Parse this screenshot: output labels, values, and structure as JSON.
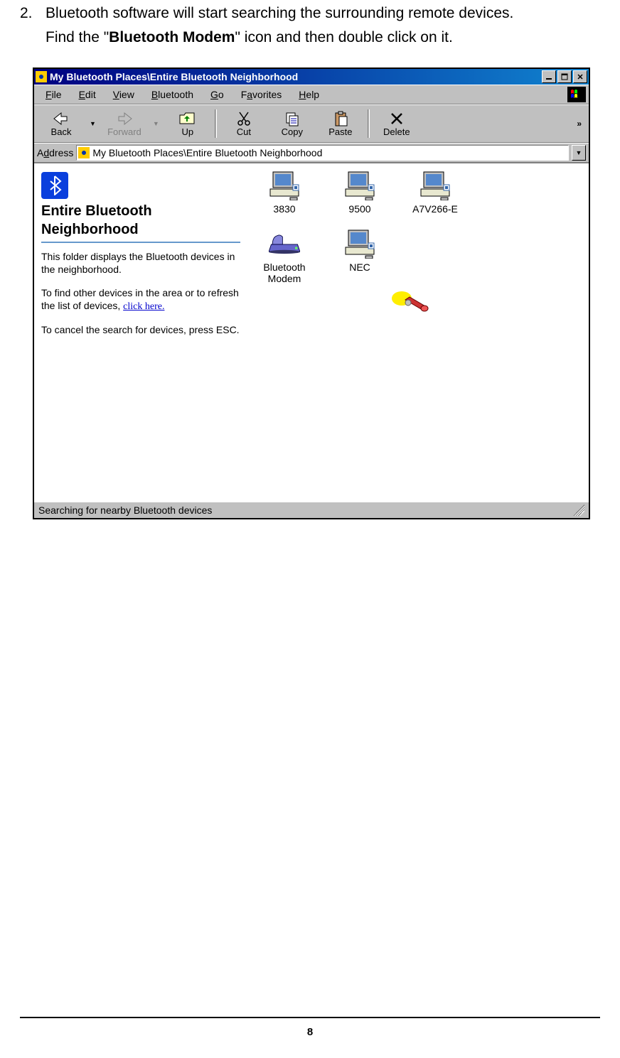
{
  "instruction": {
    "number": "2.",
    "line1": "Bluetooth software will start searching the surrounding remote devices.",
    "line2a": "Find the \"",
    "line2b": "Bluetooth Modem",
    "line2c": "\" icon and then double click on it."
  },
  "window": {
    "title": "My Bluetooth Places\\Entire Bluetooth Neighborhood",
    "menus": {
      "file": "File",
      "edit": "Edit",
      "view": "View",
      "bluetooth": "Bluetooth",
      "go": "Go",
      "favorites": "Favorites",
      "help": "Help"
    },
    "toolbar": {
      "back": "Back",
      "forward": "Forward",
      "up": "Up",
      "cut": "Cut",
      "copy": "Copy",
      "paste": "Paste",
      "delete": "Delete",
      "more": "»"
    },
    "address": {
      "label": "Address",
      "value": "My Bluetooth Places\\Entire Bluetooth Neighborhood"
    },
    "sidebar": {
      "title": "Entire Bluetooth Neighborhood",
      "p1": "This folder displays the Bluetooth devices in the neighborhood.",
      "p2": "To find other devices in the area or to refresh the list of devices,",
      "link": "click here.",
      "p3": "To cancel the search for devices, press ESC."
    },
    "devices": [
      {
        "name": "3830",
        "type": "computer"
      },
      {
        "name": "9500",
        "type": "computer"
      },
      {
        "name": "A7V266-E",
        "type": "computer"
      },
      {
        "name": "Bluetooth Modem",
        "type": "modem"
      },
      {
        "name": "NEC",
        "type": "computer"
      }
    ],
    "status": "Searching for nearby Bluetooth devices"
  },
  "page_number": "8"
}
